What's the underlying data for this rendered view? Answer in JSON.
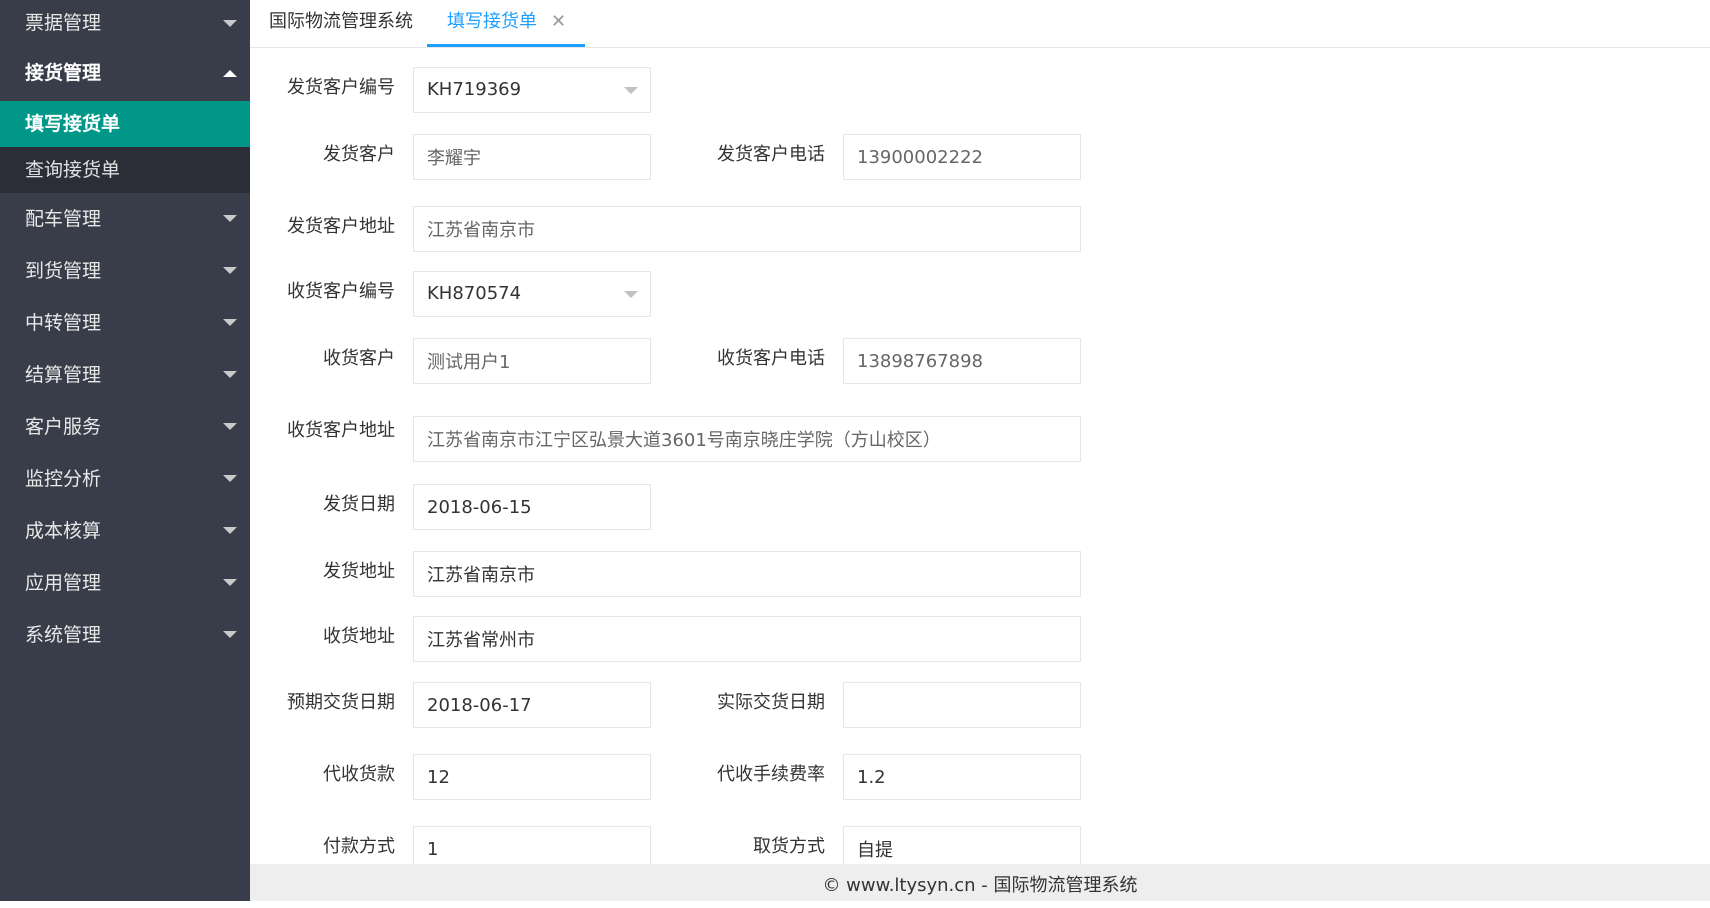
{
  "sidebar": {
    "groups": [
      {
        "label": "票据管理"
      },
      {
        "label": "接货管理",
        "sub": [
          {
            "label": "填写接货单"
          },
          {
            "label": "查询接货单"
          }
        ]
      },
      {
        "label": "配车管理"
      },
      {
        "label": "到货管理"
      },
      {
        "label": "中转管理"
      },
      {
        "label": "结算管理"
      },
      {
        "label": "客户服务"
      },
      {
        "label": "监控分析"
      },
      {
        "label": "成本核算"
      },
      {
        "label": "应用管理"
      },
      {
        "label": "系统管理"
      }
    ]
  },
  "tabs": {
    "home": "国际物流管理系统",
    "active": "填写接货单",
    "close_glyph": "✕"
  },
  "form": {
    "sender_id_label": "发货客户编号",
    "sender_id_value": "KH719369",
    "sender_name_label": "发货客户",
    "sender_name_value": "李耀宇",
    "sender_phone_label": "发货客户电话",
    "sender_phone_value": "13900002222",
    "sender_addr_label": "发货客户地址",
    "sender_addr_value": "江苏省南京市",
    "receiver_id_label": "收货客户编号",
    "receiver_id_value": "KH870574",
    "receiver_name_label": "收货客户",
    "receiver_name_value": "测试用户1",
    "receiver_phone_label": "收货客户电话",
    "receiver_phone_value": "13898767898",
    "receiver_addr_label": "收货客户地址",
    "receiver_addr_value": "江苏省南京市江宁区弘景大道3601号南京晓庄学院（方山校区）",
    "ship_date_label": "发货日期",
    "ship_date_value": "2018-06-15",
    "ship_addr_label": "发货地址",
    "ship_addr_value": "江苏省南京市",
    "recv_addr_label": "收货地址",
    "recv_addr_value": "江苏省常州市",
    "expected_date_label": "预期交货日期",
    "expected_date_value": "2018-06-17",
    "actual_date_label": "实际交货日期",
    "actual_date_value": "",
    "cod_label": "代收货款",
    "cod_value": "12",
    "cod_fee_label": "代收手续费率",
    "cod_fee_value": "1.2",
    "payment_label": "付款方式",
    "payment_value": "1",
    "pickup_label": "取货方式",
    "pickup_value": "自提"
  },
  "footer": {
    "text": "© www.ltysyn.cn - 国际物流管理系统"
  },
  "colors": {
    "sidebar_bg": "#393d49",
    "active_item": "#009688",
    "tab_accent": "#1e9fff"
  }
}
